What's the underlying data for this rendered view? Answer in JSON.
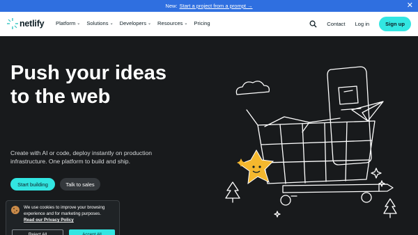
{
  "announcement": {
    "prefix": "New:",
    "link": "Start a project from a prompt →",
    "close_glyph": "✕"
  },
  "nav": {
    "logo_text": "netlify",
    "menu": [
      {
        "label": "Platform"
      },
      {
        "label": "Solutions"
      },
      {
        "label": "Developers"
      },
      {
        "label": "Resources"
      },
      {
        "label": "Pricing"
      }
    ],
    "chevron_glyph": "⌄",
    "contact": "Contact",
    "login": "Log in",
    "signup": "Sign up",
    "icons": {
      "search": "search-icon",
      "logo": "netlify-logo-icon"
    }
  },
  "hero": {
    "title_line1": "Push your ideas",
    "title_line2": "to the web",
    "subtitle": "Create with AI or code, deploy instantly on production infrastructure. One platform to build and ship.",
    "cta_primary": "Start building",
    "cta_secondary": "Talk to sales"
  },
  "cookie_banner": {
    "message": "We use cookies to improve your browsing experience and for marketing purposes.",
    "policy_link": "Read our Privacy Policy",
    "reject": "Reject All",
    "accept": "Accept All",
    "icon": "cookie-icon"
  },
  "colors": {
    "accent": "#32e6e2",
    "announcement_bg": "#2f6fe0",
    "hero_bg": "#181a1c",
    "mascot": "#f5b82e"
  }
}
